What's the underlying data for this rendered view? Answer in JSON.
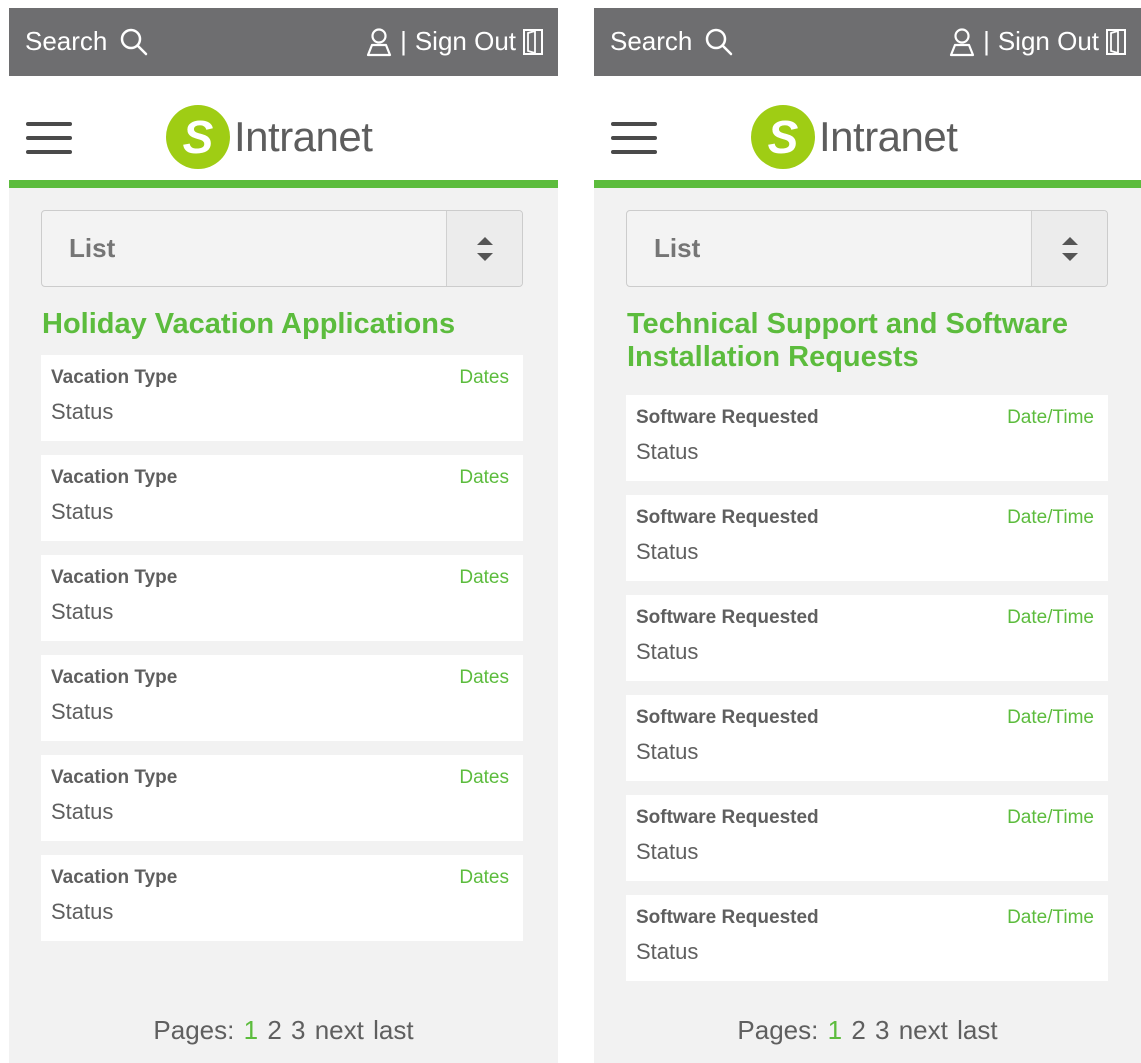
{
  "topbar": {
    "search_label": "Search",
    "separator": "|",
    "signout_label": "Sign Out"
  },
  "brand": {
    "logo_letter": "S",
    "name": "Intranet",
    "accent": "#5cbc3d",
    "logo_color": "#9fcd14"
  },
  "left": {
    "select_value": "List",
    "title": "Holiday Vacation Applications",
    "items": [
      {
        "title": "Vacation Type",
        "date": "Dates",
        "status": "Status"
      },
      {
        "title": "Vacation Type",
        "date": "Dates",
        "status": "Status"
      },
      {
        "title": "Vacation Type",
        "date": "Dates",
        "status": "Status"
      },
      {
        "title": "Vacation Type",
        "date": "Dates",
        "status": "Status"
      },
      {
        "title": "Vacation Type",
        "date": "Dates",
        "status": "Status"
      },
      {
        "title": "Vacation Type",
        "date": "Dates",
        "status": "Status"
      }
    ],
    "pager": {
      "label": "Pages:",
      "pages": [
        "1",
        "2",
        "3"
      ],
      "next": "next",
      "last": "last"
    }
  },
  "right": {
    "select_value": "List",
    "title": "Technical Support and Software Installation Requests",
    "items": [
      {
        "title": "Software Requested",
        "date": "Date/Time",
        "status": "Status"
      },
      {
        "title": "Software Requested",
        "date": "Date/Time",
        "status": "Status"
      },
      {
        "title": "Software Requested",
        "date": "Date/Time",
        "status": "Status"
      },
      {
        "title": "Software Requested",
        "date": "Date/Time",
        "status": "Status"
      },
      {
        "title": "Software Requested",
        "date": "Date/Time",
        "status": "Status"
      },
      {
        "title": "Software Requested",
        "date": "Date/Time",
        "status": "Status"
      }
    ],
    "pager": {
      "label": "Pages:",
      "pages": [
        "1",
        "2",
        "3"
      ],
      "next": "next",
      "last": "last"
    }
  }
}
